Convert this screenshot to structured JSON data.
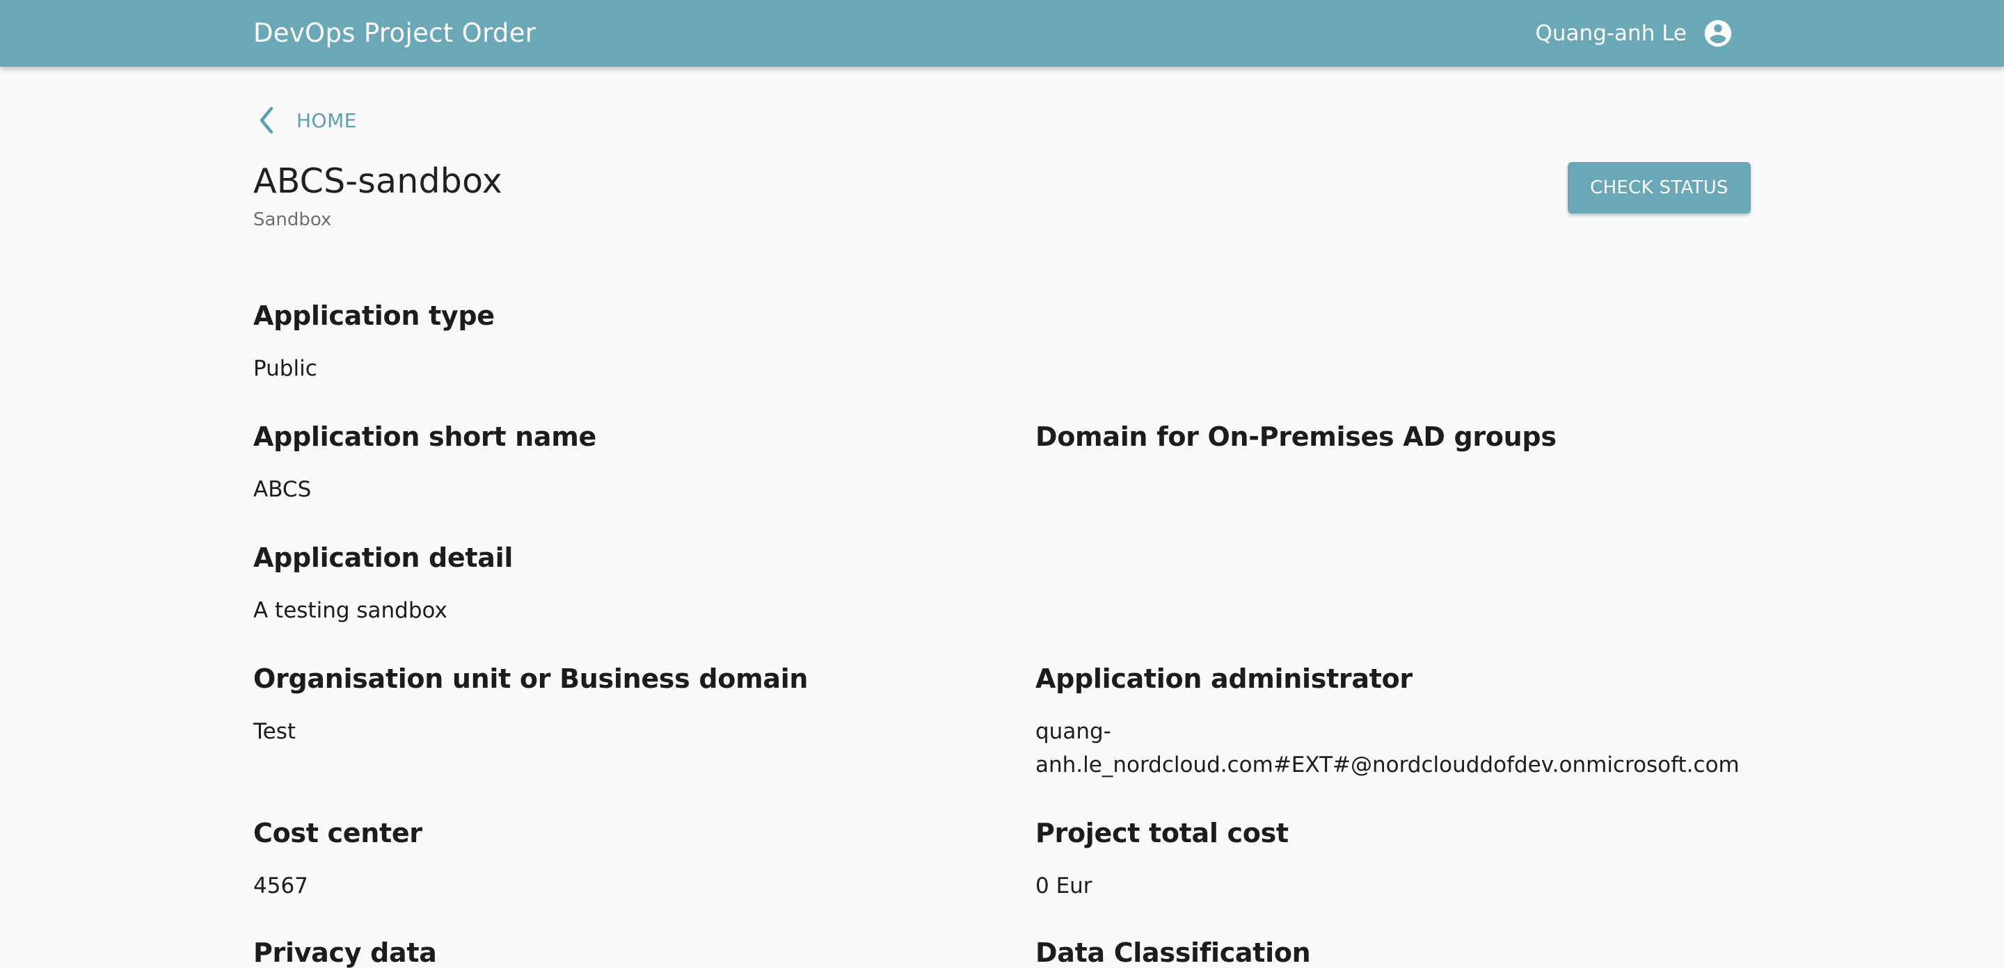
{
  "header": {
    "app_title": "DevOps Project Order",
    "user_name": "Quang-anh Le",
    "user_icon": "account-circle-icon"
  },
  "nav": {
    "back_label": "HOME",
    "back_icon": "chevron-left-icon"
  },
  "project": {
    "title": "ABCS-sandbox",
    "subtitle": "Sandbox",
    "check_status_label": "CHECK STATUS"
  },
  "fields": {
    "application_type": {
      "label": "Application type",
      "value": "Public"
    },
    "application_short_name": {
      "label": "Application short name",
      "value": "ABCS"
    },
    "domain_ad_groups": {
      "label": "Domain for On-Premises AD groups",
      "value": ""
    },
    "application_detail": {
      "label": "Application detail",
      "value": "A testing sandbox"
    },
    "organisation_unit": {
      "label": "Organisation unit or Business domain",
      "value": "Test"
    },
    "application_administrator": {
      "label": "Application administrator",
      "value_line1": "quang-",
      "value_line2": "anh.le_nordcloud.com#EXT#@nordclouddofdev.onmicrosoft.com"
    },
    "cost_center": {
      "label": "Cost center",
      "value": "4567"
    },
    "project_total_cost": {
      "label": "Project total cost",
      "value": "0 Eur"
    },
    "privacy_data": {
      "label": "Privacy data"
    },
    "data_classification": {
      "label": "Data Classification"
    }
  },
  "colors": {
    "primary": "#6aa7b7",
    "link": "#5b9fb2",
    "background": "#fafafa"
  }
}
